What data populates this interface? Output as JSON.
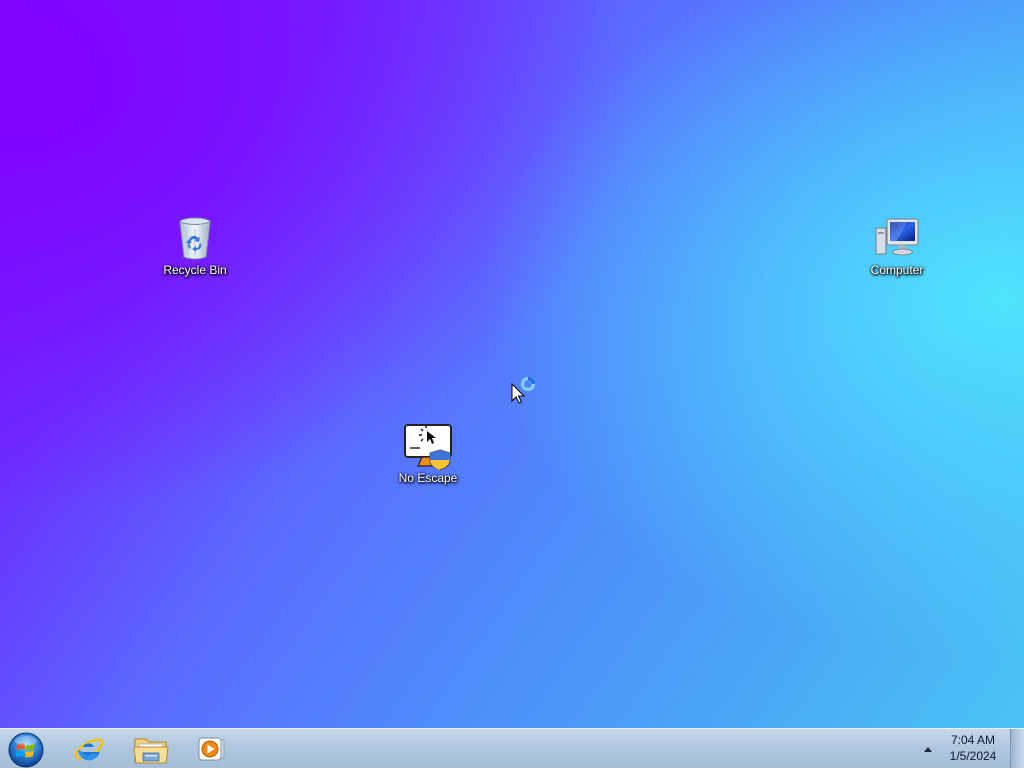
{
  "desktop": {
    "icons": [
      {
        "label": "Recycle Bin",
        "icon": "recycle-bin-icon"
      },
      {
        "label": "Computer",
        "icon": "computer-icon"
      },
      {
        "label": "No Escape",
        "icon": "no-escape-app-icon"
      }
    ]
  },
  "cursor": {
    "icon": "busy-arrow-cursor"
  },
  "taskbar": {
    "start_icon": "windows-start-orb",
    "pinned": [
      {
        "icon": "internet-explorer-icon"
      },
      {
        "icon": "file-explorer-icon"
      },
      {
        "icon": "media-player-icon"
      }
    ],
    "tray": {
      "expand_icon": "show-hidden-icons-arrow",
      "time": "7:04 AM",
      "date": "1/5/2024"
    }
  },
  "colors": {
    "wallpaper_top_left": "#7a10ff",
    "wallpaper_mid": "#4d8dfb",
    "wallpaper_right": "#50e6ff",
    "taskbar": "#b1c8df",
    "label_text": "#ffffff"
  }
}
